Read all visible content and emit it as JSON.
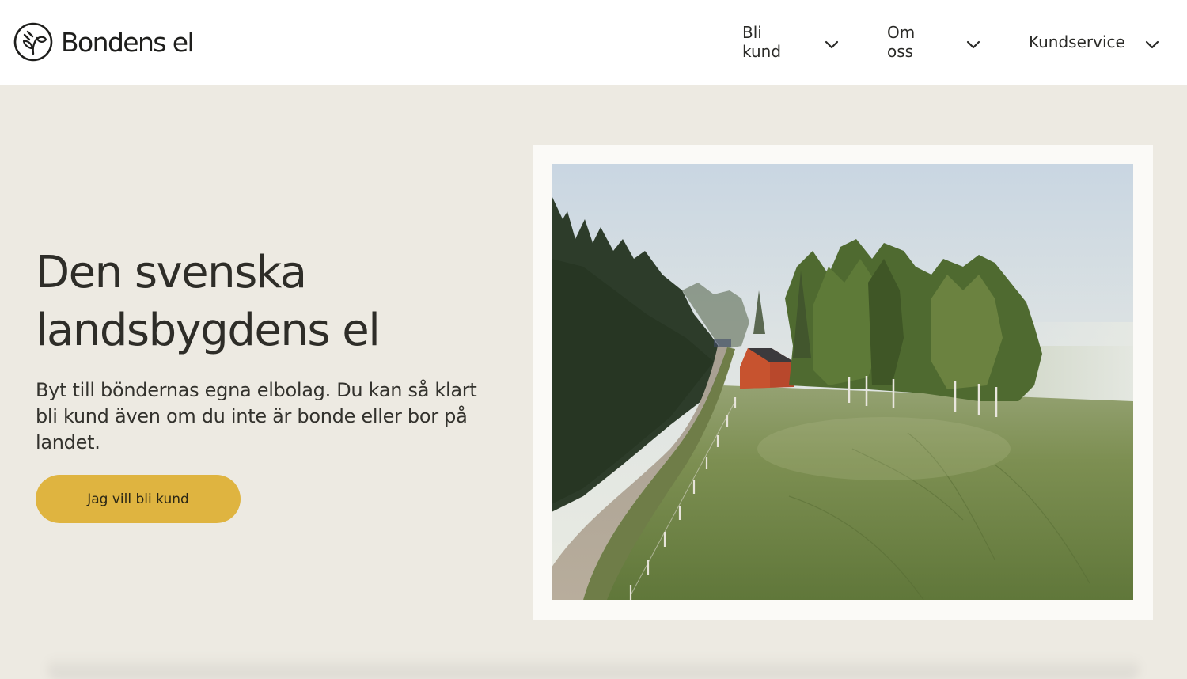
{
  "brand": {
    "name": "Bondens el",
    "logo_icon": "plug-leaf-logo-icon"
  },
  "nav": {
    "items": [
      {
        "label": "Bli kund",
        "icon": "chevron-down-icon"
      },
      {
        "label": "Om oss",
        "icon": "chevron-down-icon"
      },
      {
        "label": "Kundservice",
        "icon": "chevron-down-icon"
      }
    ]
  },
  "hero": {
    "title_line1": "Den svenska",
    "title_line2": "landsbygdens el",
    "text": "Byt till böndernas egna elbolag. Du kan så klart bli kund även om du inte är bonde eller bor på landet.",
    "cta_label": "Jag vill bli kund"
  },
  "colors": {
    "page_background": "#edeae2",
    "header_background": "#ffffff",
    "cta_background": "#dfb440",
    "text": "#2e2d28"
  }
}
